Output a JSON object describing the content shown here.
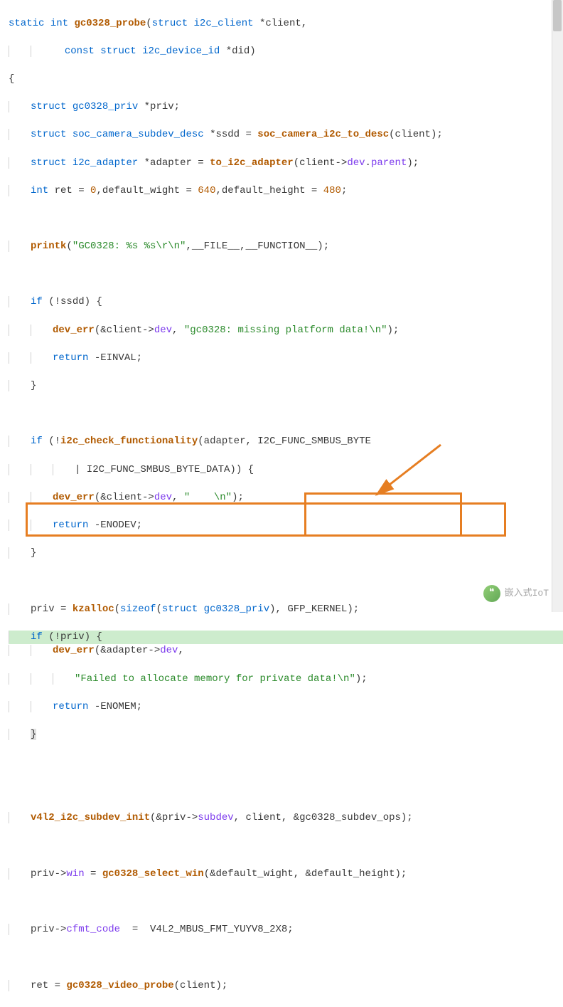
{
  "code": {
    "l1_static": "static",
    "l1_int": "int",
    "l1_fn": "gc0328_probe",
    "l1_p1a": "struct",
    "l1_p1b": "i2c_client",
    "l1_p1c": "*client,",
    "l2_const": "const",
    "l2_struct": "struct",
    "l2_type": "i2c_device_id",
    "l2_rest": "*did)",
    "l3": "{",
    "l4_struct": "struct",
    "l4_type": "gc0328_priv",
    "l4_rest": "*priv;",
    "l5_struct": "struct",
    "l5_type": "soc_camera_subdev_desc",
    "l5_rest1": "*ssdd = ",
    "l5_fn": "soc_camera_i2c_to_desc",
    "l5_rest2": "(client);",
    "l6_struct": "struct",
    "l6_type": "i2c_adapter",
    "l6_rest1": "*adapter = ",
    "l6_fn": "to_i2c_adapter",
    "l6_rest2": "(client->",
    "l6_mem1": "dev",
    "l6_dot": ".",
    "l6_mem2": "parent",
    "l6_rest3": ");",
    "l7_int": "int",
    "l7_rest1": " ret = ",
    "l7_n1": "0",
    "l7_rest2": ",default_wight = ",
    "l7_n2": "640",
    "l7_rest3": ",default_height = ",
    "l7_n3": "480",
    "l7_rest4": ";",
    "l8_fn": "printk",
    "l8_p1": "(",
    "l8_str": "\"GC0328: %s %s\\r\\n\"",
    "l8_rest": ",__FILE__,__FUNCTION__);",
    "l9_if": "if",
    "l9_rest": " (!ssdd) {",
    "l10_fn": "dev_err",
    "l10_rest1": "(&client->",
    "l10_mem": "dev",
    "l10_rest2": ", ",
    "l10_str": "\"gc0328: missing platform data!\\n\"",
    "l10_rest3": ");",
    "l11_ret": "return",
    "l11_rest": " -EINVAL;",
    "l12": "}",
    "l13_if": "if",
    "l13_rest1": " (!",
    "l13_fn": "i2c_check_functionality",
    "l13_rest2": "(adapter, I2C_FUNC_SMBUS_BYTE",
    "l14_rest": "| I2C_FUNC_SMBUS_BYTE_DATA)) {",
    "l15_fn": "dev_err",
    "l15_rest1": "(&client->",
    "l15_mem": "dev",
    "l15_rest2": ", ",
    "l15_str": "\"    \\n\"",
    "l15_rest3": ");",
    "l16_ret": "return",
    "l16_rest": " -ENODEV;",
    "l17": "}",
    "l18_rest1": "priv = ",
    "l18_fn": "kzalloc",
    "l18_rest2": "(",
    "l18_sz": "sizeof",
    "l18_rest3": "(",
    "l18_struct": "struct",
    "l18_type": " gc0328_priv",
    "l18_rest4": "), GFP_KERNEL);",
    "l19_if": "if",
    "l19_rest": " (!priv) {",
    "l20_fn": "dev_err",
    "l20_rest1": "(&adapter->",
    "l20_mem": "dev",
    "l20_rest2": ",",
    "l21_str": "\"Failed to allocate memory for private data!\\n\"",
    "l21_rest": ");",
    "l22_ret": "return",
    "l22_rest": " -ENOMEM;",
    "l23": "}",
    "l24_fn": "v4l2_i2c_subdev_init",
    "l24_rest1": "(&priv->",
    "l24_mem": "subdev",
    "l24_rest2": ", client, &gc0328_subdev_ops);",
    "l25_rest1": "priv->",
    "l25_mem": "win",
    "l25_rest2": " = ",
    "l25_fn": "gc0328_select_win",
    "l25_rest3": "(&default_wight, &default_height);",
    "l26_rest1": "priv->",
    "l26_mem": "cfmt_code",
    "l26_rest2": "  =  V4L2_MBUS_FMT_YUYV8_2X8;",
    "l27_rest1": "ret = ",
    "l27_fn": "gc0328_video_probe",
    "l27_rest2": "(client);"
  },
  "watermark": {
    "text": "嵌入式IoT"
  }
}
